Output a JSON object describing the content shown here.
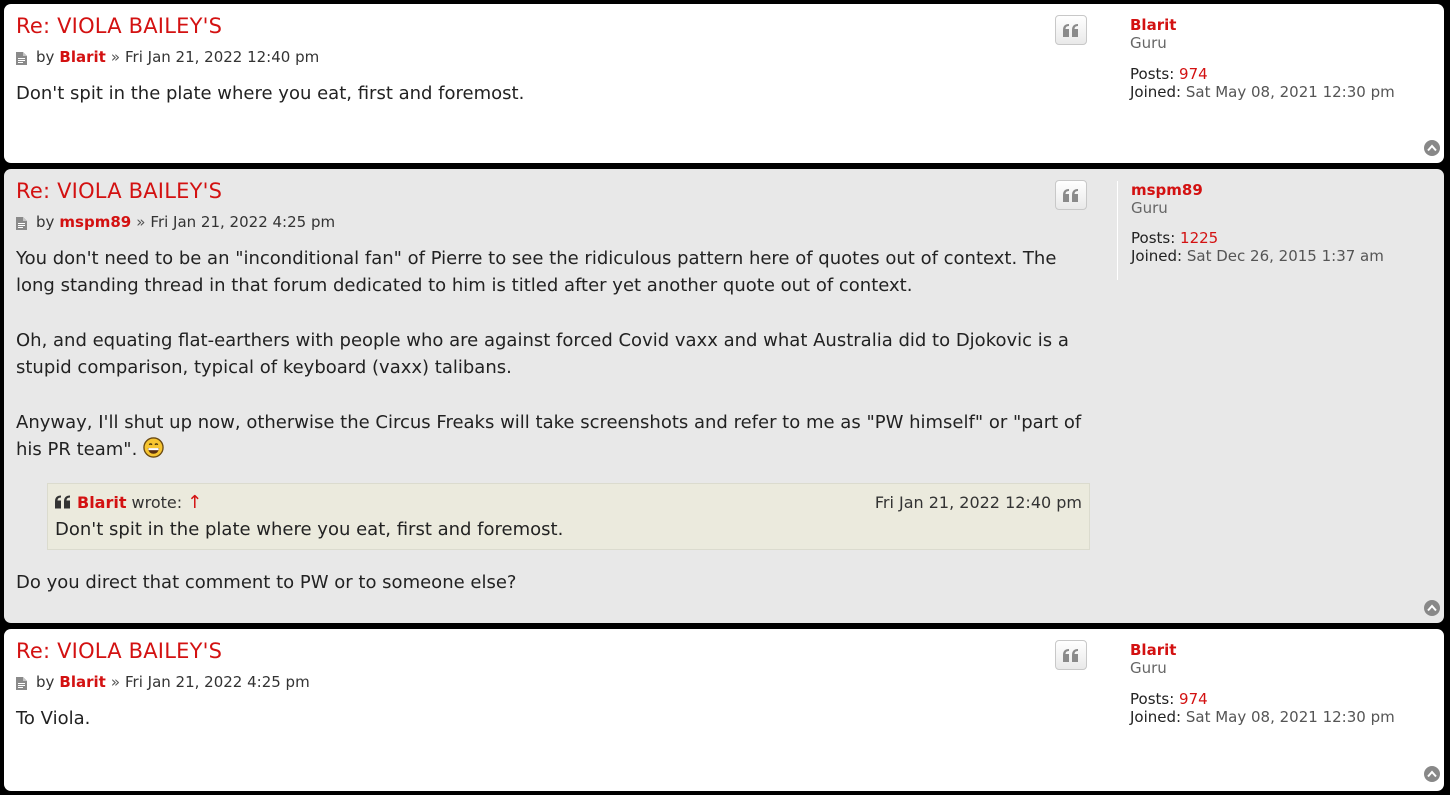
{
  "posts": [
    {
      "title": "Re: VIOLA BAILEY'S",
      "by": "by",
      "author": "Blarit",
      "sep": "»",
      "date": "Fri Jan 21, 2022 12:40 pm",
      "paragraphs": [
        "Don't spit in the plate where you eat, first and foremost."
      ],
      "profile": {
        "username": "Blarit",
        "rank": "Guru",
        "posts_label": "Posts:",
        "posts": "974",
        "joined_label": "Joined:",
        "joined": "Sat May 08, 2021 12:30 pm"
      }
    },
    {
      "title": "Re: VIOLA BAILEY'S",
      "by": "by",
      "author": "mspm89",
      "sep": "»",
      "date": "Fri Jan 21, 2022 4:25 pm",
      "paragraphs": [
        "You don't need to be an \"inconditional fan\" of Pierre to see the ridiculous pattern here of quotes out of context. The long standing thread in that forum dedicated to him is titled after yet another quote out of context.",
        "Oh, and equating flat-earthers with people who are against forced Covid vaxx and what Australia did to Djokovic is a stupid comparison, typical of keyboard (vaxx) talibans.",
        "Anyway, I'll shut up now, otherwise the Circus Freaks will take screenshots and refer to me as \"PW himself\" or \"part of his PR team\"."
      ],
      "quote": {
        "author": "Blarit",
        "wrote": "wrote:",
        "arrow": "↑",
        "date": "Fri Jan 21, 2022 12:40 pm",
        "text": "Don't spit in the plate where you eat, first and foremost."
      },
      "after_quote": "Do you direct that comment to PW or to someone else?",
      "profile": {
        "username": "mspm89",
        "rank": "Guru",
        "posts_label": "Posts:",
        "posts": "1225",
        "joined_label": "Joined:",
        "joined": "Sat Dec 26, 2015 1:37 am"
      }
    },
    {
      "title": "Re: VIOLA BAILEY'S",
      "by": "by",
      "author": "Blarit",
      "sep": "»",
      "date": "Fri Jan 21, 2022 4:25 pm",
      "paragraphs": [
        "To Viola."
      ],
      "profile": {
        "username": "Blarit",
        "rank": "Guru",
        "posts_label": "Posts:",
        "posts": "974",
        "joined_label": "Joined:",
        "joined": "Sat May 08, 2021 12:30 pm"
      }
    }
  ],
  "colors": {
    "link": "#d31111",
    "post_bg_light": "#ffffff",
    "post_bg_gray": "#e8e8e8",
    "quote_bg": "#ebeadd",
    "page_bg": "#000000"
  },
  "icons": {
    "post": "file-icon",
    "quote_button": "quote-icon",
    "back_to_top": "arrow-up-circle-icon",
    "emoji": "grinning-emoji-icon"
  }
}
